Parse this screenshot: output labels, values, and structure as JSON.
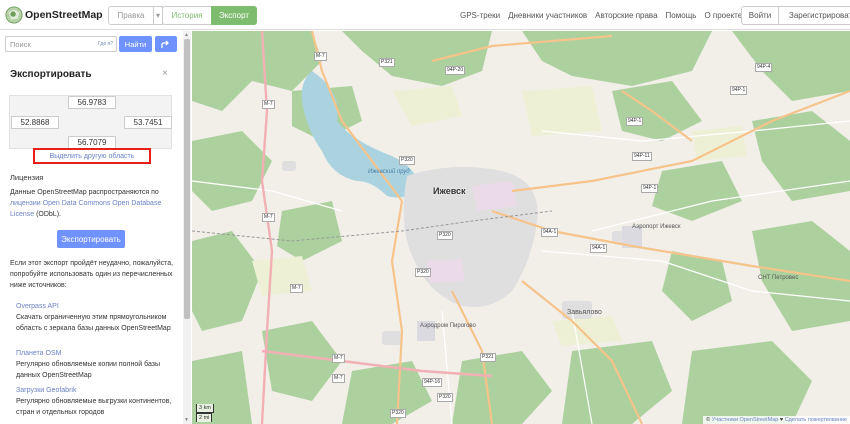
{
  "header": {
    "brand": "OpenStreetMap",
    "edit_label": "Правка",
    "caret": "▾",
    "history_label": "История",
    "export_label": "Экспорт",
    "nav": [
      "GPS-треки",
      "Дневники участников",
      "Авторские права",
      "Помощь",
      "О проекте"
    ],
    "login_label": "Войти",
    "register_label": "Зарегистрироваться"
  },
  "search": {
    "placeholder": "Поиск",
    "where_link": "Где я?",
    "go_label": "Найти"
  },
  "export_panel": {
    "title": "Экспортировать",
    "close": "×",
    "bbox": {
      "top": "56.9783",
      "left": "52.8868",
      "right": "53.7451",
      "bottom": "56.7079"
    },
    "select_other": "Выделить другую область",
    "license_title": "Лицензия",
    "license_pre": "Данные OpenStreetMap распространяются по ",
    "license_link": "лицензии Open Data Commons Open Database License",
    "license_post": " (ODbL).",
    "export_button": "Экспортировать",
    "fail_text": "Если этот экспорт пройдёт неудачно, пожалуйста, попробуйте использовать один из перечисленных ниже источников:",
    "sources": [
      {
        "name": "Overpass API",
        "desc": "Скачать ограниченную этим прямоугольником область с зеркала базы данных OpenStreetMap"
      },
      {
        "name": "Планета OSM",
        "desc": "Регулярно обновляемые копии полной базы данных OpenStreetMap"
      },
      {
        "name": "Загрузки Geofabrik",
        "desc": "Регулярно обновляемые выгрузки континентов, стран и отдельных городов"
      }
    ]
  },
  "map": {
    "city": "Ижевск",
    "labels": {
      "airport": "Аэропорт Ижевск",
      "airport2": "Аэродром Пирогово",
      "zavyalovo": "Завьялово",
      "snt": "СНТ Петровес",
      "reservoir": "Ижевский пруд"
    },
    "roads": [
      "М-7",
      "Р321",
      "94Р-20",
      "94Р-4",
      "94Р-1",
      "94Р-11",
      "94Р-1",
      "94А-1",
      "Р320",
      "Р320",
      "М-7",
      "94Р-1",
      "94А-1",
      "М-7",
      "М-7",
      "Р320",
      "94Р-16",
      "Р321",
      "М-7",
      "М-7",
      "Р320",
      "Р320"
    ],
    "scale_km": "3 km",
    "scale_mi": "2 mi",
    "attribution_pre": "© ",
    "attribution_link": "Участники OpenStreetMap",
    "attribution_post": " ♥ ",
    "attribution_link2": "Сделать пожертвование"
  },
  "colors": {
    "accent": "#7ebc6f",
    "button": "#7092ff",
    "link": "#6b82c5",
    "highlight": "#e8201a"
  }
}
